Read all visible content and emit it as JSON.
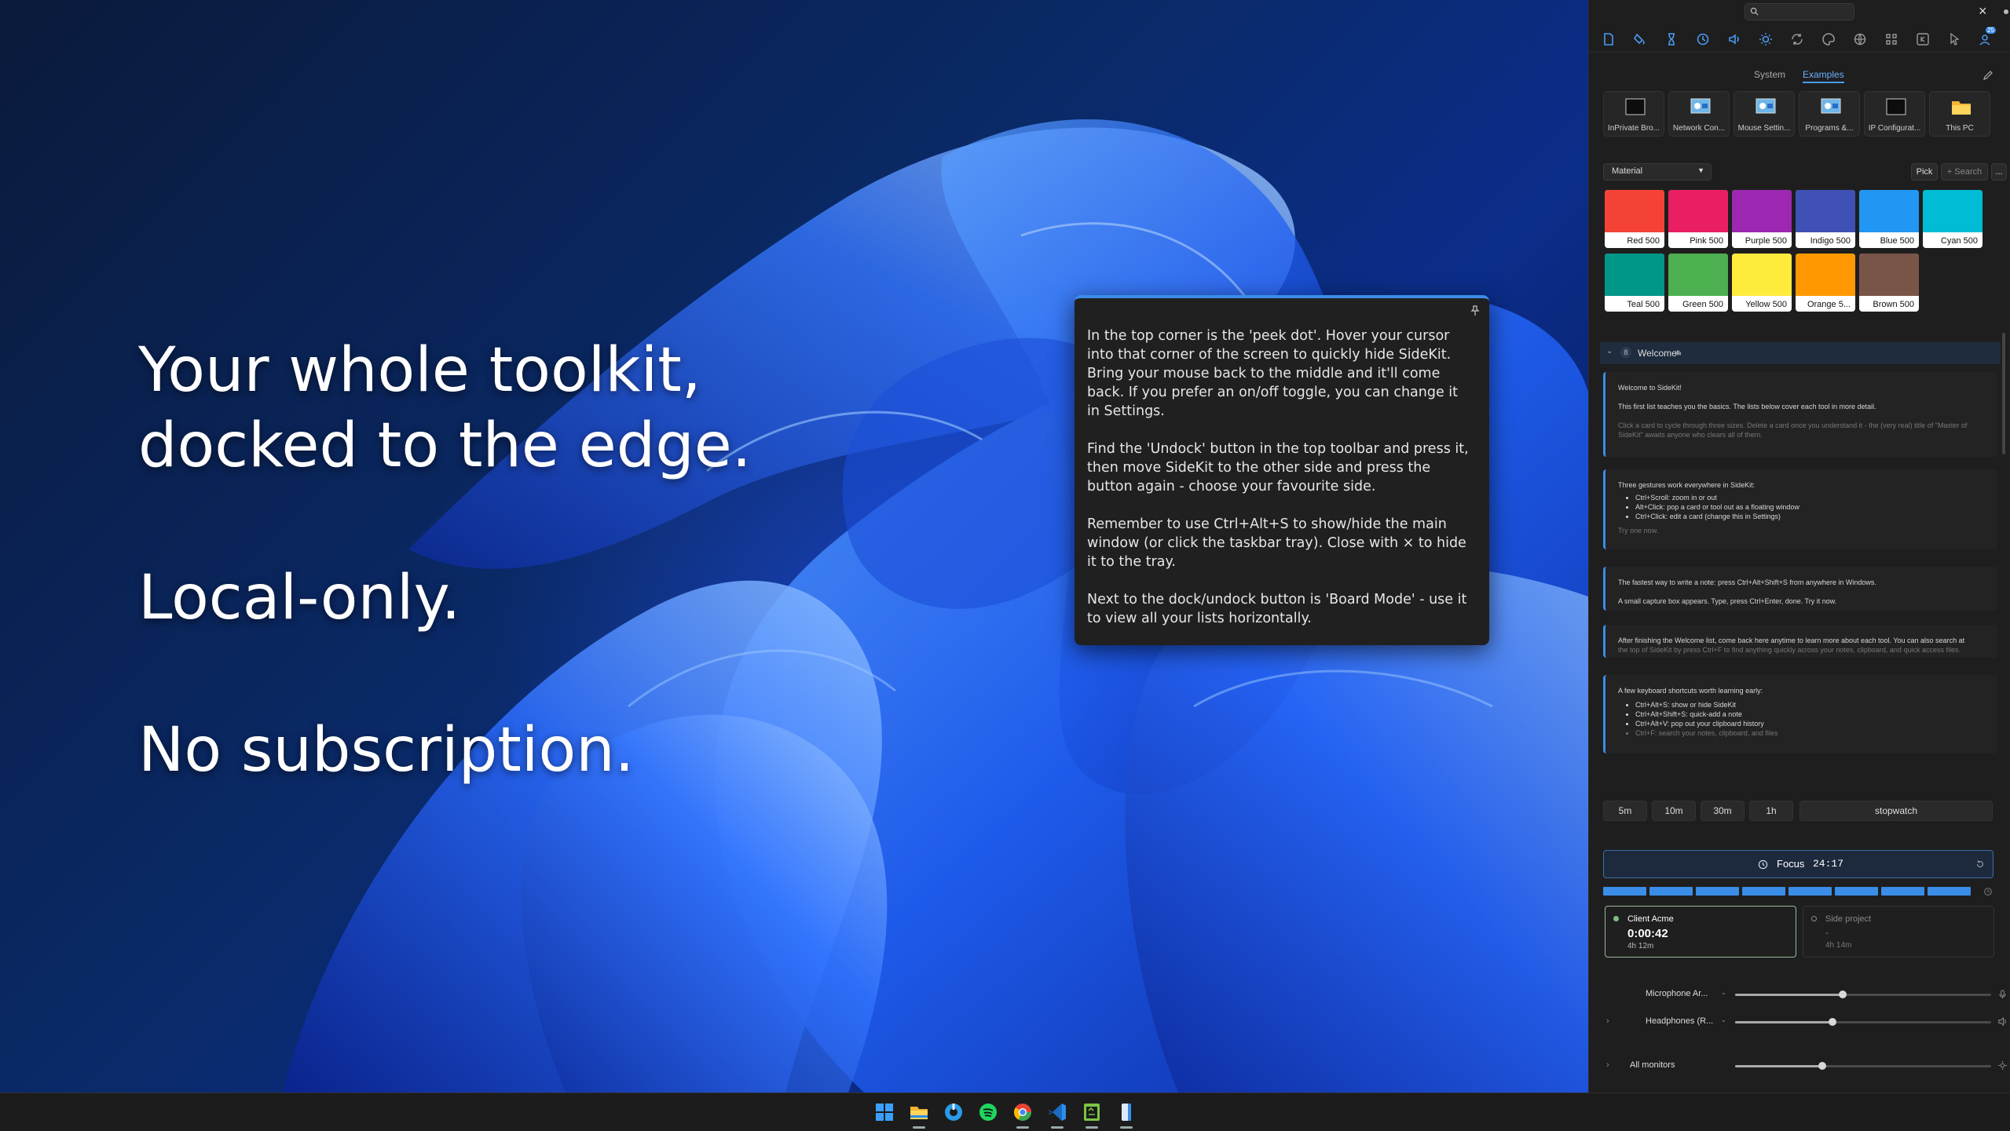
{
  "desktop": {
    "headline_line1": "Your whole toolkit,",
    "headline_line2": "docked to the edge.",
    "tagline1": "Local-only.",
    "tagline2": "No subscription."
  },
  "tip": {
    "paragraphs": [
      "In the top corner is the 'peek dot'. Hover your cursor into that corner of the screen to quickly hide SideKit. Bring your mouse back to the middle and it'll come back. If you prefer an on/off toggle, you can change it in Settings.",
      "Find the 'Undock' button in the top toolbar and press it, then move SideKit to the other side and press the button again - choose your favourite side.",
      "Remember to use Ctrl+Alt+S to show/hide the main window (or click the taskbar tray). Close with × to hide it to the tray.",
      "Next to the dock/undock button is 'Board Mode' - use it to view all your lists horizontally."
    ]
  },
  "panel": {
    "close_glyph": "×",
    "toolbar_badge": "25",
    "tabs": [
      "System",
      "Examples"
    ],
    "active_tab": "Examples",
    "shortcuts": [
      {
        "label": "InPrivate Bro...",
        "icon": "window-icon"
      },
      {
        "label": "Network Con...",
        "icon": "control-panel-icon"
      },
      {
        "label": "Mouse Settin...",
        "icon": "control-panel-icon"
      },
      {
        "label": "Programs &...",
        "icon": "control-panel-icon"
      },
      {
        "label": "IP Configurat...",
        "icon": "window-icon"
      },
      {
        "label": "This PC",
        "icon": "folder-icon"
      }
    ],
    "palette": {
      "selected": "Material",
      "pick_label": "Pick",
      "search_placeholder": "+ Search",
      "more_label": "...",
      "swatches": [
        {
          "name": "Red 500",
          "color": "#F44336"
        },
        {
          "name": "Pink 500",
          "color": "#E91E63"
        },
        {
          "name": "Purple 500",
          "color": "#9C27B0"
        },
        {
          "name": "Indigo 500",
          "color": "#3F51B5"
        },
        {
          "name": "Blue 500",
          "color": "#2196F3"
        },
        {
          "name": "Cyan 500",
          "color": "#00BCD4"
        },
        {
          "name": "Teal 500",
          "color": "#009688"
        },
        {
          "name": "Green 500",
          "color": "#4CAF50"
        },
        {
          "name": "Yellow 500",
          "color": "#FFEB3B"
        },
        {
          "name": "Orange 5...",
          "color": "#FF9800"
        },
        {
          "name": "Brown 500",
          "color": "#795548"
        }
      ]
    },
    "list": {
      "count": "8",
      "title": "Welcome",
      "cards": [
        {
          "title": "Welcome to SideKit!",
          "body": "This first list teaches you the basics. The lists below cover each tool in more detail.",
          "faint": "Click a card to cycle through three sizes. Delete a card once you understand it - the (very real) title of \"Master of SideKit\" awaits anyone who clears all of them."
        },
        {
          "title": "Three gestures work everywhere in SideKit:",
          "items": [
            "Ctrl+Scroll: zoom in or out",
            "Alt+Click: pop a card or tool out as a floating window",
            "Ctrl+Click: edit a card (change this in Settings)"
          ],
          "faint": "Try one now."
        },
        {
          "title": "The fastest way to write a note: press Ctrl+Alt+Shift+S from anywhere in Windows.",
          "body": "A small capture box appears. Type, press Ctrl+Enter, done. Try it now."
        },
        {
          "title": "After finishing the Welcome list, come back here anytime to learn more about each tool. You can also search at",
          "faint": "the top of SideKit by press Ctrl+F to find anything quickly across your notes, clipboard, and quick access files."
        },
        {
          "title": "A few keyboard shortcuts worth learning early:",
          "items": [
            "Ctrl+Alt+S: show or hide SideKit",
            "Ctrl+Alt+Shift+S: quick-add a note",
            "Ctrl+Alt+V: pop out your clipboard history"
          ],
          "faint_item": "Ctrl+F: search your notes, clipboard, and files"
        }
      ]
    },
    "timer": {
      "presets": [
        "5m",
        "10m",
        "30m",
        "1h"
      ],
      "stopwatch_label": "stopwatch",
      "focus_label": "Focus",
      "focus_time": "24:17",
      "progress_segments": 8
    },
    "projects": [
      {
        "name": "Client Acme",
        "elapsed": "0:00:42",
        "total": "4h 12m",
        "active": true
      },
      {
        "name": "Side project",
        "elapsed": "-",
        "total": "4h 14m",
        "active": false
      }
    ],
    "audio": [
      {
        "label": "Microphone Ar...",
        "level": 0.42,
        "icon": "microphone-icon"
      },
      {
        "label": "Headphones (R...",
        "level": 0.38,
        "icon": "speaker-icon"
      }
    ],
    "monitors": {
      "label": "All monitors",
      "level": 0.34
    }
  },
  "colors": {
    "accent": "#3a8de8",
    "panel_bg": "#1e1e1e",
    "taskbar_bg": "#1c1c1c"
  }
}
